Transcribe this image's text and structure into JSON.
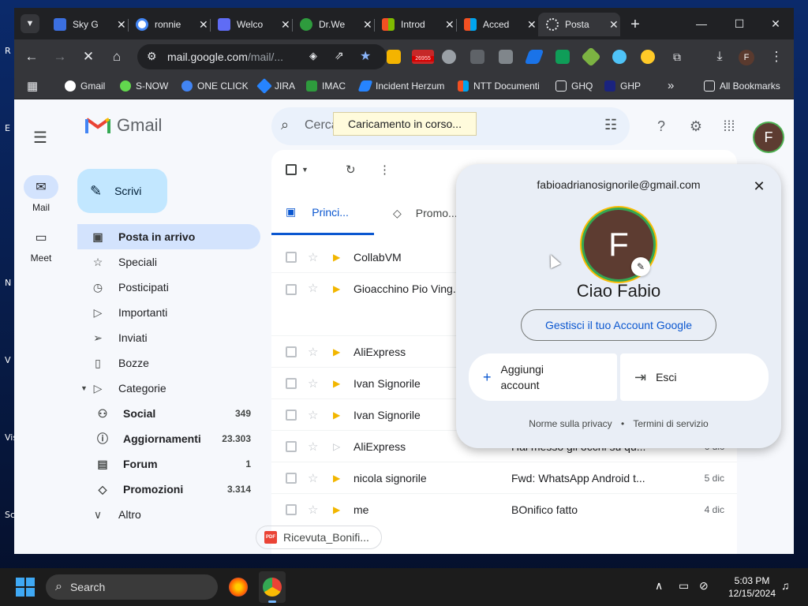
{
  "desktop": {
    "edge_letters": [
      "R",
      "E",
      "N",
      "V",
      "Vis",
      "Sc"
    ]
  },
  "browser": {
    "tabs": [
      {
        "label": "Sky G",
        "favicon_color": "#3b6fe0"
      },
      {
        "label": "ronnie",
        "favicon_color": "#ffffff"
      },
      {
        "label": "Welco",
        "favicon_color": "#5f6cf5"
      },
      {
        "label": "Dr.We",
        "favicon_color": "#2e9b3d"
      },
      {
        "label": "Introd",
        "favicon_color": "#f25022"
      },
      {
        "label": "Acced",
        "favicon_color": "#f25022"
      },
      {
        "label": "Posta",
        "favicon_color": "#c5221f"
      }
    ],
    "close_glyph": "✕",
    "new_tab_glyph": "+",
    "window_controls": [
      "—",
      "☐",
      "✕"
    ],
    "url_host": "mail.google.com",
    "url_path": "/mail/...",
    "extension_badge": "26955",
    "profile_initial": "F",
    "bookmarks": [
      {
        "label": "Gmail",
        "color": "#ffffff"
      },
      {
        "label": "S-NOW",
        "color": "#62d84e"
      },
      {
        "label": "ONE CLICK",
        "color": "#4285f4"
      },
      {
        "label": "JIRA",
        "color": "#2684ff"
      },
      {
        "label": "IMAC",
        "color": "#2e9b3d"
      },
      {
        "label": "Incident Herzum",
        "color": "#2684ff"
      },
      {
        "label": "NTT Documenti",
        "color": "#f25022"
      },
      {
        "label": "GHQ",
        "color": "#e8eaed"
      },
      {
        "label": "GHP",
        "color": "#e8eaed"
      }
    ],
    "more_bookmarks_glyph": "»",
    "all_bookmarks": "All Bookmarks"
  },
  "gmail": {
    "logo_text": "Gmail",
    "search_placeholder": "Cerca nella posta",
    "loading_tooltip": "Caricamento in corso...",
    "rail": [
      {
        "label": "Mail"
      },
      {
        "label": "Meet"
      }
    ],
    "compose_label": "Scrivi",
    "nav": [
      {
        "label": "Posta in arrivo",
        "count": ""
      },
      {
        "label": "Speciali",
        "count": ""
      },
      {
        "label": "Posticipati",
        "count": ""
      },
      {
        "label": "Importanti",
        "count": ""
      },
      {
        "label": "Inviati",
        "count": ""
      },
      {
        "label": "Bozze",
        "count": ""
      },
      {
        "label": "Categorie",
        "count": ""
      },
      {
        "label": "Social",
        "count": "349"
      },
      {
        "label": "Aggiornamenti",
        "count": "23.303"
      },
      {
        "label": "Forum",
        "count": "1"
      },
      {
        "label": "Promozioni",
        "count": "3.314"
      },
      {
        "label": "Altro",
        "count": ""
      }
    ],
    "mail_tabs": [
      {
        "label": "Princi..."
      },
      {
        "label": "Promo..."
      }
    ],
    "rows": [
      {
        "sender": "CollabVM",
        "subject": "",
        "date": ""
      },
      {
        "sender": "Gioacchino Pio Ving...",
        "subject": "",
        "date": ""
      },
      {
        "sender": "AliExpress",
        "subject": "",
        "date": ""
      },
      {
        "sender": "Ivan Signorile",
        "subject": "",
        "date": ""
      },
      {
        "sender": "Ivan Signorile",
        "subject": "",
        "date": ""
      },
      {
        "sender": "AliExpress",
        "subject": "Hai messo gli occhi su qu...",
        "date": "6 dic"
      },
      {
        "sender": "nicola signorile",
        "subject": "Fwd: WhatsApp Android t...",
        "date": "5 dic"
      },
      {
        "sender": "me",
        "subject": "BOnifico fatto",
        "date": "4 dic"
      }
    ],
    "attachment": {
      "badge": "PDF",
      "name": "Ricevuta_Bonifi..."
    }
  },
  "account_popup": {
    "email": "fabioadrianosignorile@gmail.com",
    "initial": "F",
    "greeting": "Ciao Fabio",
    "manage_label": "Gestisci il tuo Account Google",
    "add_account_line1": "Aggiungi",
    "add_account_line2": "account",
    "signout_label": "Esci",
    "privacy": "Norme sulla privacy",
    "separator": "•",
    "terms": "Termini di servizio"
  },
  "taskbar": {
    "search_label": "Search",
    "time": "5:03 PM",
    "date": "12/15/2024"
  }
}
